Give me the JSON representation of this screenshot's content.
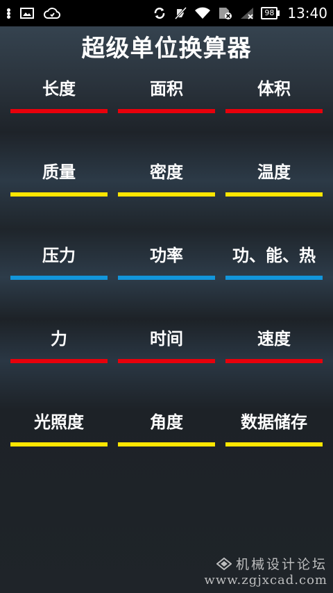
{
  "status_bar": {
    "time": "13:40",
    "battery": "98",
    "icons": [
      "more-dots-icon",
      "image-notification-icon",
      "cloud-icon",
      "sync-icon",
      "silent-icon",
      "wifi-icon",
      "sim-icon",
      "signal-icon",
      "battery-icon"
    ]
  },
  "app": {
    "title": "超级单位换算器"
  },
  "converters": [
    {
      "label": "长度",
      "color": "#e8000b"
    },
    {
      "label": "面积",
      "color": "#e8000b"
    },
    {
      "label": "体积",
      "color": "#e8000b"
    },
    {
      "label": "质量",
      "color": "#ffe600"
    },
    {
      "label": "密度",
      "color": "#ffe600"
    },
    {
      "label": "温度",
      "color": "#ffe600"
    },
    {
      "label": "压力",
      "color": "#1296db"
    },
    {
      "label": "功率",
      "color": "#1296db"
    },
    {
      "label": "功、能、热",
      "color": "#1296db"
    },
    {
      "label": "力",
      "color": "#e8000b"
    },
    {
      "label": "时间",
      "color": "#e8000b"
    },
    {
      "label": "速度",
      "color": "#e8000b"
    },
    {
      "label": "光照度",
      "color": "#ffe600"
    },
    {
      "label": "角度",
      "color": "#ffe600"
    },
    {
      "label": "数据储存",
      "color": "#ffe600"
    }
  ],
  "watermark": {
    "line1": "机械设计论坛",
    "line2": "www.zgjxcad.com"
  }
}
